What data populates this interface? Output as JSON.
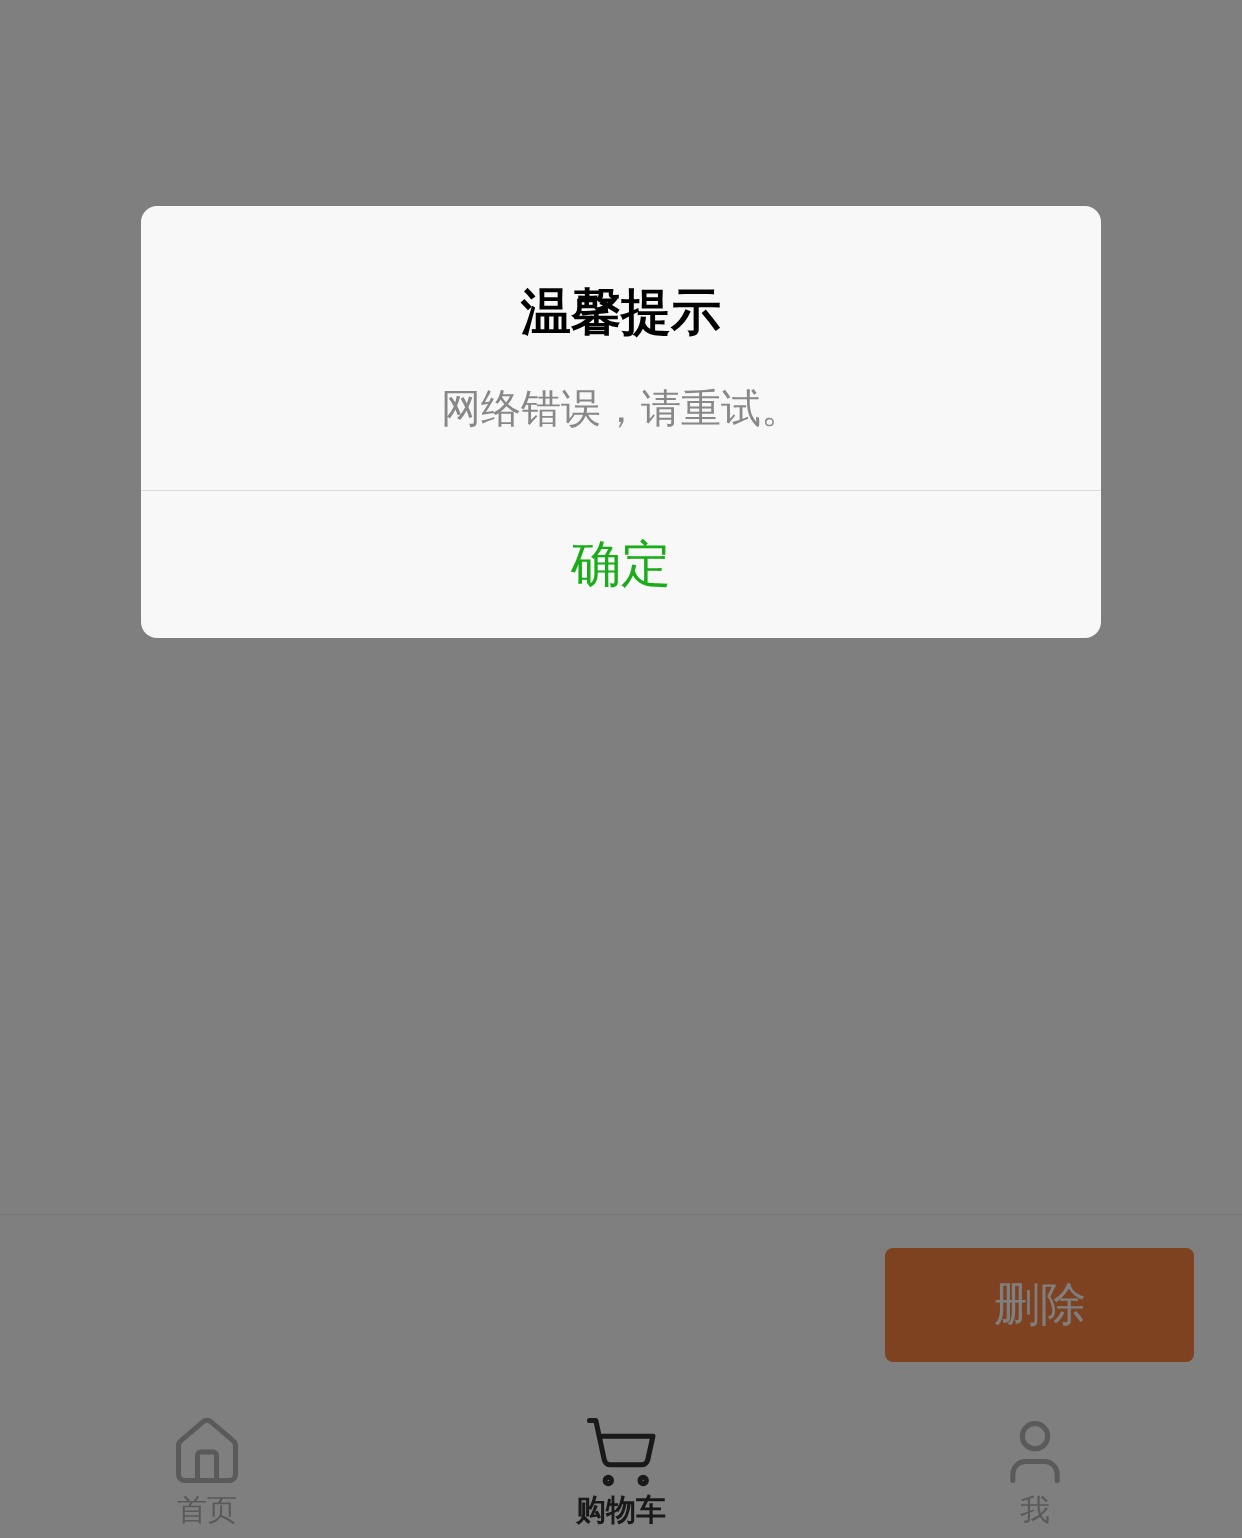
{
  "action_bar": {
    "delete_button": "删除"
  },
  "tab_bar": [
    {
      "label": "首页",
      "selected": false
    },
    {
      "label": "购物车",
      "selected": true
    },
    {
      "label": "我",
      "selected": false
    }
  ],
  "dialog": {
    "title": "温馨提示",
    "message": "网络错误，请重试。",
    "confirm_button": "确定"
  }
}
